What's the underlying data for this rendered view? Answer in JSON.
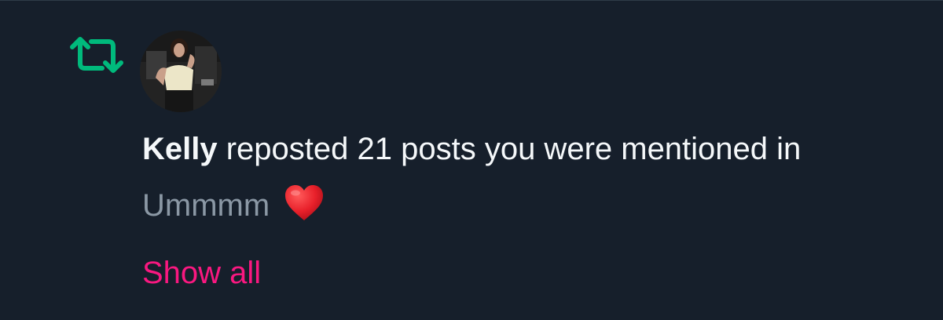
{
  "notification": {
    "type_icon": "repost-icon",
    "accent_color": "#00ba7c",
    "avatar": "user-avatar-photo",
    "actor_name": "Kelly",
    "action_text": " reposted 21 posts you were mentioned in",
    "post_snippet": "Ummmm",
    "snippet_emoji": "red-heart-icon",
    "show_all_label": "Show all",
    "link_color": "#f91880"
  }
}
